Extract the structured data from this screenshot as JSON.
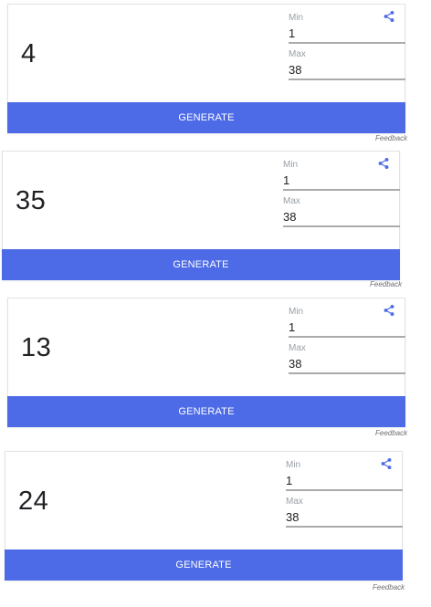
{
  "accent_color": "#4d6be6",
  "share_icon": "share-icon",
  "widgets": [
    {
      "result": "4",
      "min_label": "Min",
      "min_value": "1",
      "max_label": "Max",
      "max_value": "38",
      "button_label": "GENERATE",
      "feedback_label": "Feedback"
    },
    {
      "result": "35",
      "min_label": "Min",
      "min_value": "1",
      "max_label": "Max",
      "max_value": "38",
      "button_label": "GENERATE",
      "feedback_label": "Feedback"
    },
    {
      "result": "13",
      "min_label": "Min",
      "min_value": "1",
      "max_label": "Max",
      "max_value": "38",
      "button_label": "GENERATE",
      "feedback_label": "Feedback"
    },
    {
      "result": "24",
      "min_label": "Min",
      "min_value": "1",
      "max_label": "Max",
      "max_value": "38",
      "button_label": "GENERATE",
      "feedback_label": "Feedback"
    }
  ]
}
